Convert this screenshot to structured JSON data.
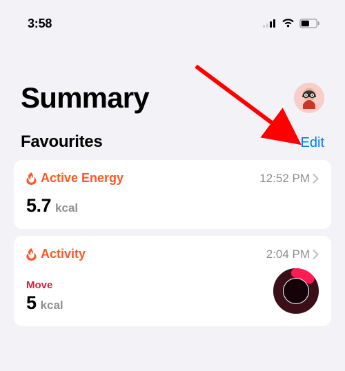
{
  "status": {
    "time": "3:58"
  },
  "header": {
    "title": "Summary"
  },
  "section": {
    "title": "Favourites",
    "edit_label": "Edit"
  },
  "cards": [
    {
      "icon": "flame-icon",
      "title": "Active Energy",
      "time": "12:52 PM",
      "value": "5.7",
      "unit": "kcal"
    },
    {
      "icon": "flame-icon",
      "title": "Activity",
      "time": "2:04 PM",
      "sub_label": "Move",
      "value": "5",
      "unit": "kcal"
    }
  ]
}
